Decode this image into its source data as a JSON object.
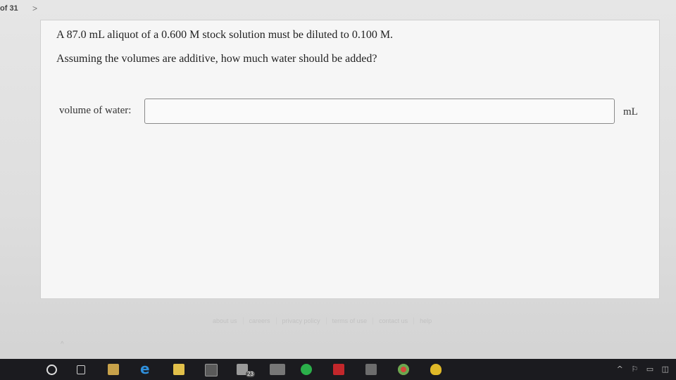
{
  "pager": {
    "text": "of 31",
    "next_icon": ">"
  },
  "question": {
    "line1": "A 87.0 mL aliquot of a 0.600 M stock solution must be diluted to 0.100 M.",
    "line2": "Assuming the volumes are additive, how much water should be added?"
  },
  "answer_field": {
    "label": "volume of water:",
    "value": "",
    "unit": "mL"
  },
  "footer": {
    "links": [
      "about us",
      "careers",
      "privacy policy",
      "terms of use",
      "contact us",
      "help"
    ]
  },
  "taskbar": {
    "icons": [
      "cortana-icon",
      "task-view-icon",
      "store-icon",
      "edge-icon",
      "file-explorer-icon",
      "calculator-icon",
      "mail-icon",
      "news-icon",
      "spotify-icon",
      "mcafee-icon",
      "photos-icon",
      "chrome-icon",
      "app-icon"
    ],
    "badge": "23",
    "tray": "^ ⚐ ▭ ◫"
  }
}
